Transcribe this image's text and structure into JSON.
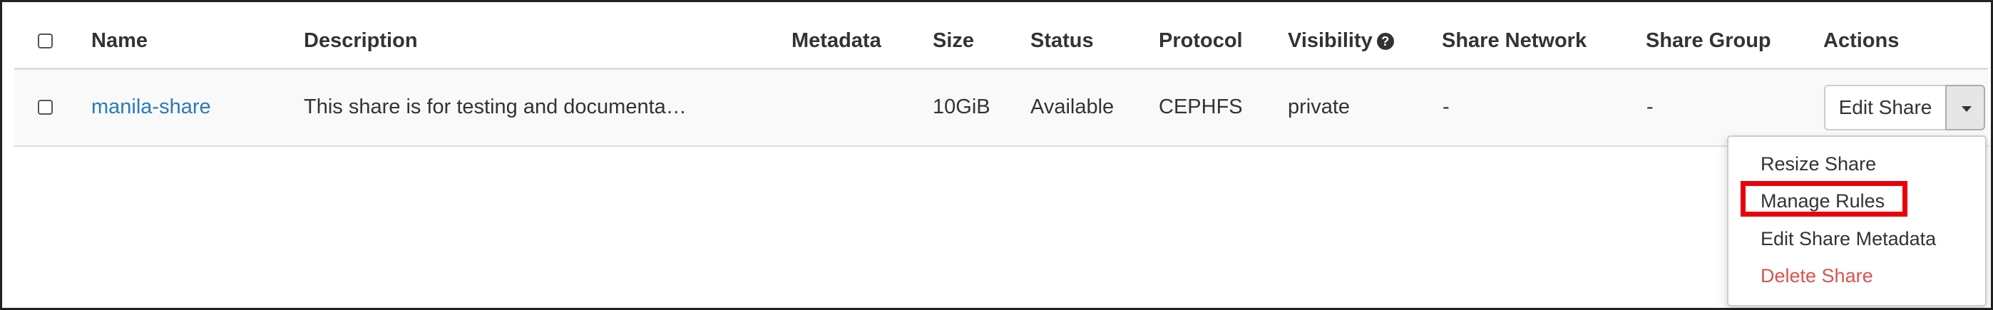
{
  "table": {
    "headers": {
      "name": "Name",
      "description": "Description",
      "metadata": "Metadata",
      "size": "Size",
      "status": "Status",
      "protocol": "Protocol",
      "visibility": "Visibility",
      "share_network": "Share Network",
      "share_group": "Share Group",
      "actions": "Actions"
    },
    "rows": [
      {
        "name": "manila-share",
        "description": "This share is for testing and documenta…",
        "metadata": "",
        "size": "10GiB",
        "status": "Available",
        "protocol": "CEPHFS",
        "visibility": "private",
        "share_network": "-",
        "share_group": "-",
        "action_label": "Edit Share"
      }
    ]
  },
  "icons": {
    "visibility_help": "question-circle-icon",
    "help_glyph": "?",
    "dropdown_toggle": "caret-down-icon"
  },
  "actions_menu": {
    "items": [
      {
        "label": "Resize Share",
        "danger": false
      },
      {
        "label": "Manage Rules",
        "danger": false,
        "highlighted": true
      },
      {
        "label": "Edit Share Metadata",
        "danger": false
      },
      {
        "label": "Delete Share",
        "danger": true
      }
    ]
  },
  "colors": {
    "link": "#2a7ab8",
    "danger": "#d9534f",
    "highlight": "#e8000b",
    "text": "#333333",
    "row_background": "#f9f9f9"
  }
}
